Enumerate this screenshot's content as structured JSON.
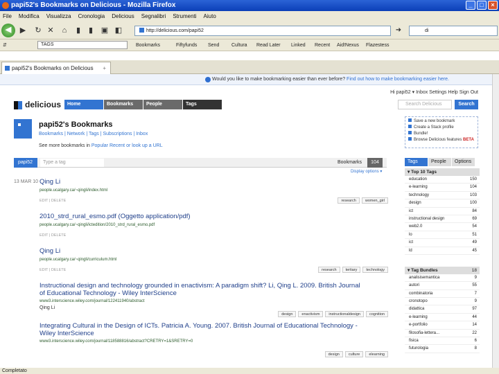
{
  "window": {
    "title": "papi52's Bookmarks on Delicious - Mozilla Firefox",
    "menu": [
      "File",
      "Modifica",
      "Visualizza",
      "Cronologia",
      "Delicious",
      "Segnalibri",
      "Strumenti",
      "Aiuto"
    ],
    "url": "http://delicious.com/papi52",
    "search_value": "di",
    "status": "Completato"
  },
  "bookmarks_toolbar": {
    "search_value": "TAGS",
    "items": [
      "Bookmarks",
      "Fiftyfunds",
      "Send",
      "Cultura",
      "Read Later",
      "Linked",
      "Recent",
      "Aid!Nexus",
      "Flazestess"
    ]
  },
  "tab": {
    "title": "papi52's Bookmarks on Delicious"
  },
  "notice": {
    "text": "Would you like to make bookmarking easier than ever before?",
    "link": "Find out how to make bookmarking easier here."
  },
  "userbar": "Hi papi52 ▾   Inbox   Settings   Help   Sign Out",
  "site": {
    "logo": "delicious",
    "nav": [
      "Home",
      "Bookmarks",
      "People",
      "Tags"
    ],
    "search_placeholder": "Search Delicious",
    "search_button": "Search"
  },
  "user": {
    "name": "papi52's Bookmarks",
    "nav": "Bookmarks  |  Network  |  Tags  |  Subscriptions  |  Inbox",
    "subnav_prefix": "See more bookmarks in",
    "subnav_links": "Popular  Recent  or look up a URL"
  },
  "sidelinks": [
    "Save a new bookmark",
    "Create a Stack profile",
    "Bundle!",
    "Browse Delicious features"
  ],
  "sidelinks_beta": "BETA",
  "filter": {
    "tag": "papi52",
    "placeholder": "Type a tag",
    "label": "Bookmarks",
    "count": "104",
    "display_options": "Display options ▾"
  },
  "bookmarks": [
    {
      "date": "13 MAR 10",
      "title": "Qing Li",
      "url": "people.ucalgary.ca/~qingli/index.html",
      "edit": "EDIT | DELETE",
      "tags": [
        "research",
        "women_girl"
      ]
    },
    {
      "date": "",
      "title": "2010_strd_rural_esmo.pdf (Oggetto application/pdf)",
      "url": "people.ucalgary.ca/~qingli/ictedition/2010_strd_rural_esmo.pdf",
      "edit": "EDIT | DELETE",
      "tags": []
    },
    {
      "date": "",
      "title": "Qing Li",
      "url": "people.ucalgary.ca/~qingli/curriculum.html",
      "edit": "EDIT | DELETE",
      "tags": [
        "research",
        "tertiary",
        "technology"
      ]
    },
    {
      "date": "",
      "title": "Instructional design and technology grounded in enactivism: A paradigm shift? Li, Qing L. 2009. British Journal of Educational Technology - Wiley InterScience",
      "url": "www3.interscience.wiley.com/journal/122411940/abstract",
      "note": "Qing Li",
      "edit": "",
      "tags": [
        "design",
        "enactivism",
        "instructionaldesign",
        "cognition"
      ]
    },
    {
      "date": "",
      "title": "Integrating Cultural in the Design of ICTs. Patricia A. Young. 2007. British Journal of Educational Technology - Wiley InterScience",
      "url": "www3.interscience.wiley.com/journal/118588816/abstract?CRETRY=1&SRETRY=0",
      "note": "",
      "edit": "",
      "tags": [
        "design",
        "culture",
        "elearning"
      ]
    }
  ],
  "right": {
    "tabs": [
      "Tags",
      "People",
      "Options ▾"
    ],
    "top_tags_title": "Top 10 Tags",
    "top_tags_count": "",
    "top_tags": [
      {
        "name": "education",
        "count": "150"
      },
      {
        "name": "e-learning",
        "count": "104"
      },
      {
        "name": "technology",
        "count": "103"
      },
      {
        "name": "design",
        "count": "100"
      },
      {
        "name": "ict",
        "count": "84"
      },
      {
        "name": "instructional design",
        "count": "69"
      },
      {
        "name": "web2.0",
        "count": "54"
      },
      {
        "name": "lo",
        "count": "51"
      },
      {
        "name": "ict",
        "count": "49"
      },
      {
        "name": "ld",
        "count": "45"
      }
    ],
    "bundles_title": "Tag Bundles",
    "bundles_count": "18",
    "bundles": [
      {
        "name": "analisisemantica",
        "count": "9"
      },
      {
        "name": "autori",
        "count": "55"
      },
      {
        "name": "combinatoria",
        "count": "7"
      },
      {
        "name": "cronotopo",
        "count": "9"
      },
      {
        "name": "didattica",
        "count": "97"
      },
      {
        "name": "e-learning",
        "count": "44"
      },
      {
        "name": "e-portfolio",
        "count": "14"
      },
      {
        "name": "filosofia-lettera...",
        "count": "22"
      },
      {
        "name": "fisica",
        "count": "6"
      },
      {
        "name": "futurologia",
        "count": "8"
      }
    ]
  }
}
